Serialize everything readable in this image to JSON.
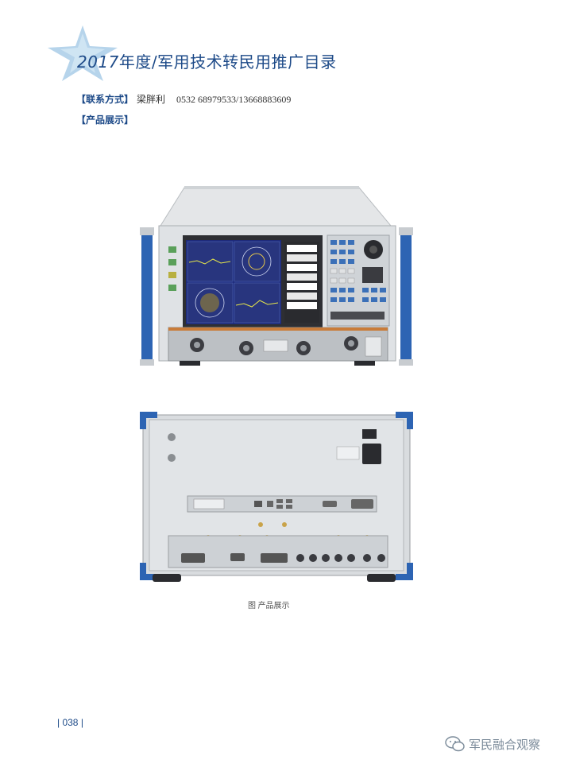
{
  "header": {
    "year": "2017",
    "title": "年度/军用技术转民用推广目录"
  },
  "contact": {
    "label": "【联系方式】",
    "name": "梁胖利",
    "phone": "0532 68979533/13668883609"
  },
  "product_section": {
    "label": "【产品展示】"
  },
  "figure": {
    "caption": "图    产品展示"
  },
  "footer": {
    "page_number": "038",
    "watermark": "军民融合观察"
  },
  "colors": {
    "title_blue": "#1d4a88",
    "star_blue": "#a9cde8",
    "handle_blue": "#2d64b3",
    "panel_gray": "#d7dadd",
    "screen_blue": "#1e2a7a"
  }
}
